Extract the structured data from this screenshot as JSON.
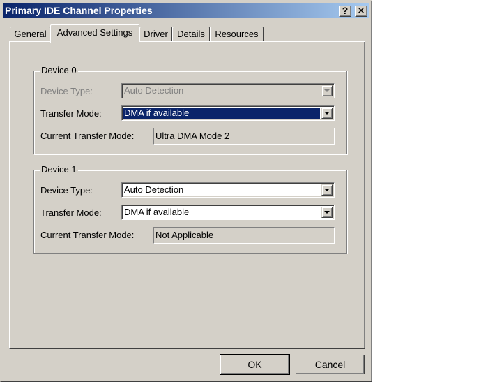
{
  "window": {
    "title": "Primary IDE Channel Properties",
    "help_label": "?",
    "close_label": "✕"
  },
  "tabs": [
    {
      "label": "General"
    },
    {
      "label": "Advanced Settings"
    },
    {
      "label": "Driver"
    },
    {
      "label": "Details"
    },
    {
      "label": "Resources"
    }
  ],
  "device0": {
    "group_label": "Device 0",
    "device_type_label": "Device Type:",
    "device_type_value": "Auto Detection",
    "transfer_mode_label": "Transfer Mode:",
    "transfer_mode_value": "DMA if available",
    "current_mode_label": "Current Transfer Mode:",
    "current_mode_value": "Ultra DMA Mode 2"
  },
  "device1": {
    "group_label": "Device 1",
    "device_type_label": "Device Type:",
    "device_type_value": "Auto Detection",
    "transfer_mode_label": "Transfer Mode:",
    "transfer_mode_value": "DMA if available",
    "current_mode_label": "Current Transfer Mode:",
    "current_mode_value": "Not Applicable"
  },
  "buttons": {
    "ok": "OK",
    "cancel": "Cancel"
  }
}
